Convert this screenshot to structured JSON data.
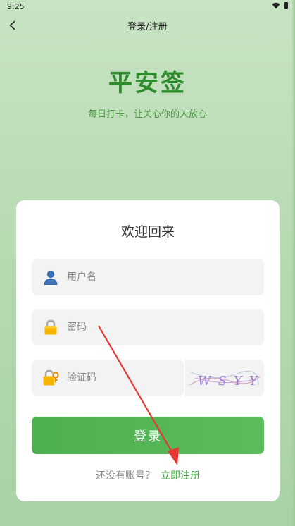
{
  "status_bar": {
    "time": "9:25"
  },
  "nav": {
    "title": "登录/注册"
  },
  "brand": {
    "title": "平安签",
    "slogan": "每日打卡，让关心你的人放心"
  },
  "card": {
    "title": "欢迎回来",
    "username_placeholder": "用户名",
    "password_placeholder": "密码",
    "captcha_placeholder": "验证码",
    "captcha_text": "WSYY",
    "login_label": "登录",
    "register_prompt": "还没有账号？",
    "register_link": "立即注册"
  },
  "colors": {
    "brand_green": "#2e8b2e",
    "button_green": "#4caf50",
    "annotation_red": "#e53935"
  },
  "icons": {
    "back": "chevron-left-icon",
    "username": "user-icon",
    "password": "lock-icon",
    "captcha": "lock-key-icon"
  }
}
